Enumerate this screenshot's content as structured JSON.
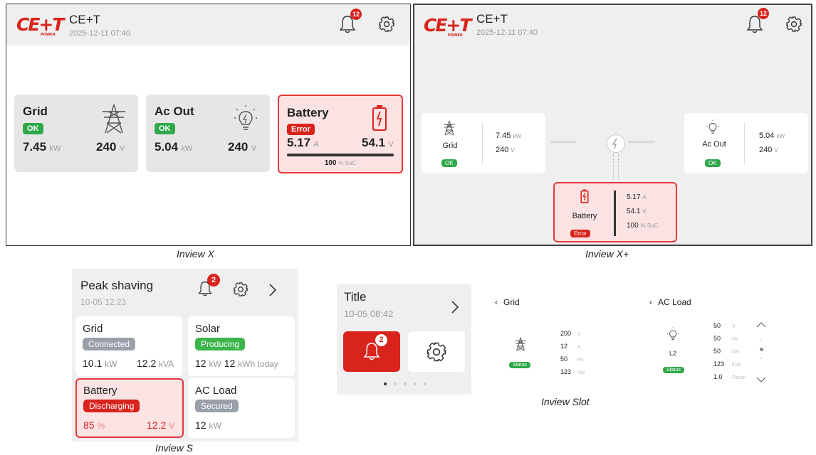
{
  "colors": {
    "accent": "#d9231d",
    "ok": "#2fa84a",
    "error_bg": "#fbe3e3",
    "card": "#e6e6e6"
  },
  "x": {
    "logo": "CE+T",
    "logo_sub": "POWER",
    "title": "CE+T",
    "timestamp": "2025-12-11 07:40",
    "notif_count": "12",
    "grid": {
      "label": "Grid",
      "status": "OK",
      "power": "7.45",
      "power_unit": "kW",
      "voltage": "240",
      "voltage_unit": "V"
    },
    "acout": {
      "label": "Ac Out",
      "status": "OK",
      "power": "5.04",
      "power_unit": "kW",
      "voltage": "240",
      "voltage_unit": "V"
    },
    "battery": {
      "label": "Battery",
      "status": "Error",
      "current": "5.17",
      "current_unit": "A",
      "voltage": "54.1",
      "voltage_unit": "V",
      "soc": "100",
      "soc_unit": "% SoC",
      "soc_fraction": 1.0
    },
    "caption": "Inview X"
  },
  "xplus": {
    "logo": "CE+T",
    "logo_sub": "POWER",
    "title": "CE+T",
    "timestamp": "2025-12-11 07:40",
    "notif_count": "12",
    "grid": {
      "label": "Grid",
      "status": "OK",
      "power": "7.45",
      "power_unit": "kW",
      "voltage": "240",
      "voltage_unit": "V"
    },
    "acout": {
      "label": "Ac Out",
      "status": "OK",
      "power": "5.04",
      "power_unit": "kW",
      "voltage": "240",
      "voltage_unit": "V"
    },
    "battery": {
      "label": "Battery",
      "status": "Error",
      "current": "5.17",
      "current_unit": "A",
      "voltage": "54.1",
      "voltage_unit": "V",
      "soc": "100",
      "soc_unit": "% SoC"
    },
    "flow_left": ">>>>>>>>>>>>",
    "flow_right": ">>>>>>>>>>>>",
    "caption": "Inview X+"
  },
  "s": {
    "title": "Peak shaving",
    "timestamp": "10-05 12:23",
    "notif_count": "2",
    "grid": {
      "label": "Grid",
      "status": "Connected",
      "v1": "10.1",
      "u1": "kW",
      "v2": "12.2",
      "u2": "kVA"
    },
    "solar": {
      "label": "Solar",
      "status": "Producing",
      "v1": "12",
      "u1": "kW",
      "v2": "12",
      "u2": "kWh today"
    },
    "battery": {
      "label": "Battery",
      "status": "Discharging",
      "v1": "85",
      "u1": "%",
      "v2": "12.2",
      "u2": "V"
    },
    "acload": {
      "label": "AC Load",
      "status": "Secured",
      "v1": "12",
      "u1": "kW"
    },
    "caption": "Inview S"
  },
  "slot": {
    "title": "Title",
    "timestamp": "10-05 08:42",
    "notif_count": "2",
    "page_count": "5",
    "grid": {
      "label": "Grid",
      "status": "Status",
      "rows": [
        {
          "v": "200",
          "u": "V"
        },
        {
          "v": "12",
          "u": "A"
        },
        {
          "v": "50",
          "u": "Hz"
        },
        {
          "v": "123",
          "u": "kW"
        }
      ]
    },
    "acload": {
      "label": "AC Load",
      "sub": "L2",
      "status": "Status",
      "rows": [
        {
          "v": "50",
          "u": "V"
        },
        {
          "v": "50",
          "u": "Hz"
        },
        {
          "v": "50",
          "u": "kW"
        },
        {
          "v": "123",
          "u": "kVA"
        },
        {
          "v": "1.0",
          "u": "Factor"
        }
      ]
    },
    "caption": "Inview Slot"
  }
}
